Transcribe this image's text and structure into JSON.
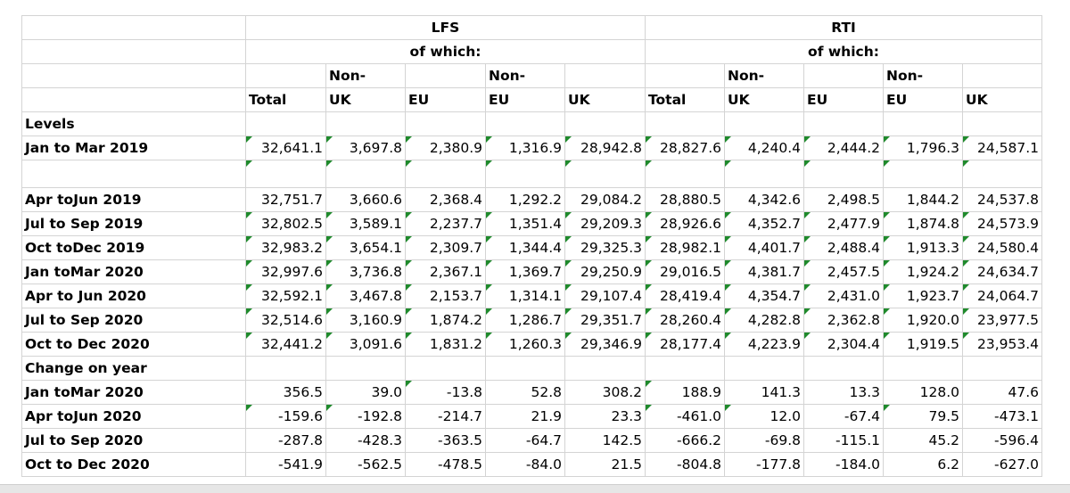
{
  "headers": {
    "lfs": "LFS",
    "rti": "RTI",
    "of_which": "of which:",
    "non": "Non-",
    "total": "Total",
    "uk": "UK",
    "eu": "EU"
  },
  "sections": {
    "levels": "Levels",
    "change": "Change on year"
  },
  "first_row": {
    "label": "Jan to Mar 2019",
    "values": [
      "32,641.1",
      "3,697.8",
      "2,380.9",
      "1,316.9",
      "28,942.8",
      "28,827.6",
      "4,240.4",
      "2,444.2",
      "1,796.3",
      "24,587.1"
    ]
  },
  "levels_rows": [
    {
      "label": "Apr toJun 2019",
      "values": [
        "32,751.7",
        "3,660.6",
        "2,368.4",
        "1,292.2",
        "29,084.2",
        "28,880.5",
        "4,342.6",
        "2,498.5",
        "1,844.2",
        "24,537.8"
      ]
    },
    {
      "label": "Jul to Sep 2019",
      "values": [
        "32,802.5",
        "3,589.1",
        "2,237.7",
        "1,351.4",
        "29,209.3",
        "28,926.6",
        "4,352.7",
        "2,477.9",
        "1,874.8",
        "24,573.9"
      ]
    },
    {
      "label": "Oct toDec 2019",
      "values": [
        "32,983.2",
        "3,654.1",
        "2,309.7",
        "1,344.4",
        "29,325.3",
        "28,982.1",
        "4,401.7",
        "2,488.4",
        "1,913.3",
        "24,580.4"
      ]
    },
    {
      "label": "Jan toMar 2020",
      "values": [
        "32,997.6",
        "3,736.8",
        "2,367.1",
        "1,369.7",
        "29,250.9",
        "29,016.5",
        "4,381.7",
        "2,457.5",
        "1,924.2",
        "24,634.7"
      ]
    },
    {
      "label": "Apr to Jun 2020",
      "values": [
        "32,592.1",
        "3,467.8",
        "2,153.7",
        "1,314.1",
        "29,107.4",
        "28,419.4",
        "4,354.7",
        "2,431.0",
        "1,923.7",
        "24,064.7"
      ]
    },
    {
      "label": "Jul to Sep 2020",
      "values": [
        "32,514.6",
        "3,160.9",
        "1,874.2",
        "1,286.7",
        "29,351.7",
        "28,260.4",
        "4,282.8",
        "2,362.8",
        "1,920.0",
        "23,977.5"
      ]
    },
    {
      "label": "Oct to Dec 2020",
      "values": [
        "32,441.2",
        "3,091.6",
        "1,831.2",
        "1,260.3",
        "29,346.9",
        "28,177.4",
        "4,223.9",
        "2,304.4",
        "1,919.5",
        "23,953.4"
      ]
    }
  ],
  "change_rows": [
    {
      "label": "Jan toMar 2020",
      "values": [
        "356.5",
        "39.0",
        "-13.8",
        "52.8",
        "308.2",
        "188.9",
        "141.3",
        "13.3",
        "128.0",
        "47.6"
      ]
    },
    {
      "label": "Apr toJun 2020",
      "values": [
        "-159.6",
        "-192.8",
        "-214.7",
        "21.9",
        "23.3",
        "-461.0",
        "12.0",
        "-67.4",
        "79.5",
        "-473.1"
      ]
    },
    {
      "label": "Jul to Sep 2020",
      "values": [
        "-287.8",
        "-428.3",
        "-363.5",
        "-64.7",
        "142.5",
        "-666.2",
        "-69.8",
        "-115.1",
        "45.2",
        "-596.4"
      ]
    },
    {
      "label": "Oct to Dec 2020",
      "values": [
        "-541.9",
        "-562.5",
        "-478.5",
        "-84.0",
        "21.5",
        "-804.8",
        "-177.8",
        "-184.0",
        "6.2",
        "-627.0"
      ]
    }
  ],
  "colors": {
    "error_indicator": "#1f8a2c",
    "gridline": "#d4d4d4"
  }
}
